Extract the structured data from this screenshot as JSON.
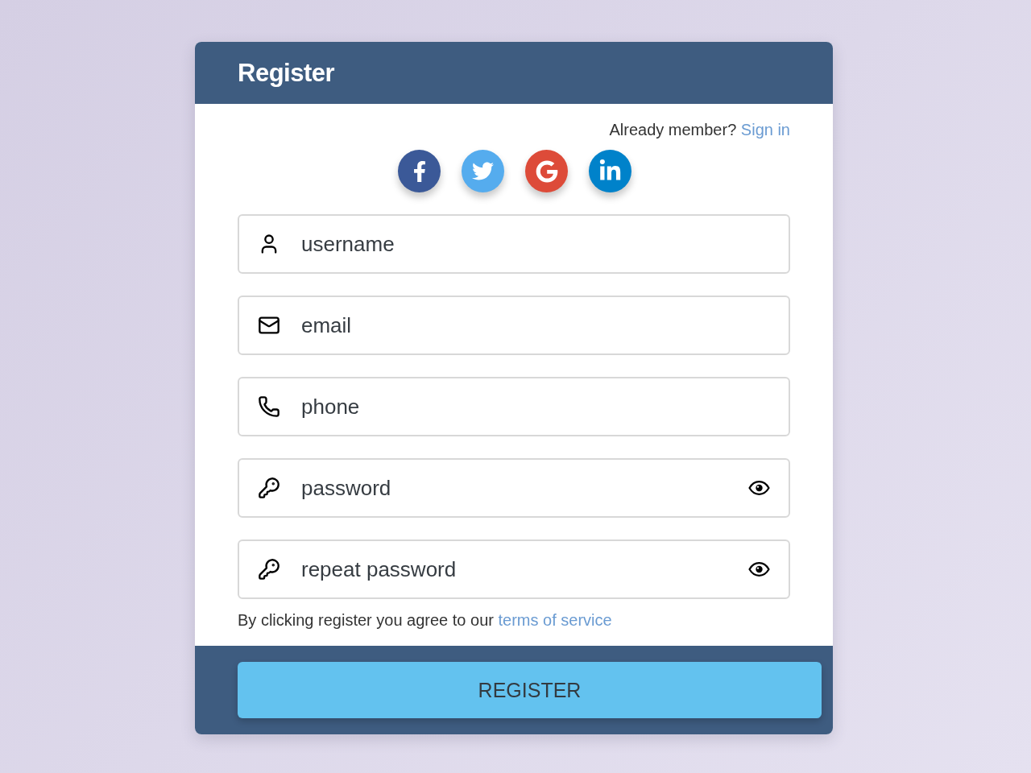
{
  "header": {
    "title": "Register"
  },
  "signin_prompt": {
    "text": "Already member?",
    "link": "Sign in"
  },
  "social_buttons": [
    {
      "kind": "facebook",
      "color": "#3b5998"
    },
    {
      "kind": "twitter",
      "color": "#55acee"
    },
    {
      "kind": "google",
      "color": "#dd4b39"
    },
    {
      "kind": "linkedin",
      "color": "#0082ca"
    }
  ],
  "fields": [
    {
      "kind": "user",
      "placeholder": "username"
    },
    {
      "kind": "email",
      "placeholder": "email"
    },
    {
      "kind": "phone",
      "placeholder": "phone"
    },
    {
      "kind": "password",
      "placeholder": "password"
    },
    {
      "kind": "password",
      "placeholder": "repeat password"
    }
  ],
  "terms": {
    "text": "By clicking register you agree to our",
    "link": "terms of service"
  },
  "submit_button": {
    "label": "REGISTER"
  }
}
